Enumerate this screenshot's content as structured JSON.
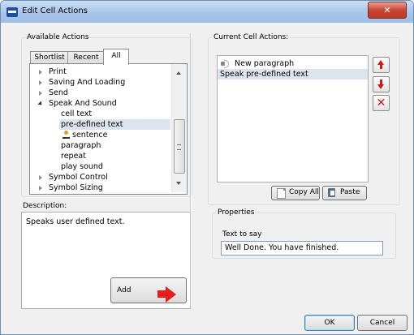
{
  "window": {
    "title": "Edit Cell Actions",
    "close_glyph": "✕"
  },
  "available": {
    "group_title": "Available Actions",
    "tabs": [
      {
        "label": "Shortlist",
        "active": false
      },
      {
        "label": "Recent",
        "active": false
      },
      {
        "label": "All",
        "active": true
      }
    ],
    "tree": [
      {
        "label": "Print",
        "level": 0,
        "expander": "closed"
      },
      {
        "label": "Saving And Loading",
        "level": 0,
        "expander": "closed"
      },
      {
        "label": "Send",
        "level": 0,
        "expander": "closed"
      },
      {
        "label": "Speak And Sound",
        "level": 0,
        "expander": "open"
      },
      {
        "label": "cell text",
        "level": 1
      },
      {
        "label": "pre-defined text",
        "level": 1,
        "selected": true
      },
      {
        "label": "sentence",
        "level": 1,
        "icon": "sentence-icon"
      },
      {
        "label": "paragraph",
        "level": 1
      },
      {
        "label": "repeat",
        "level": 1
      },
      {
        "label": "play sound",
        "level": 1
      },
      {
        "label": "Symbol Control",
        "level": 0,
        "expander": "closed"
      },
      {
        "label": "Symbol Sizing",
        "level": 0,
        "expander": "closed"
      }
    ],
    "description_label": "Description:",
    "description_text": "Speaks user defined text.",
    "add_label": "Add"
  },
  "current": {
    "group_title": "Current Cell Actions:",
    "items": [
      {
        "label": "New paragraph",
        "icon": "speaker-icon",
        "selected": false
      },
      {
        "label": "Speak pre-defined text",
        "selected": true
      }
    ],
    "copy_all_label": "Copy All",
    "paste_label": "Paste",
    "properties_title": "Properties",
    "text_to_say_label": "Text to say",
    "text_to_say_value": "Well Done. You have finished."
  },
  "footer": {
    "ok_label": "OK",
    "cancel_label": "Cancel"
  },
  "colors": {
    "accent_red": "#e41d1d",
    "selection": "#dde4ee",
    "title_bar": "#a9c6ea"
  }
}
